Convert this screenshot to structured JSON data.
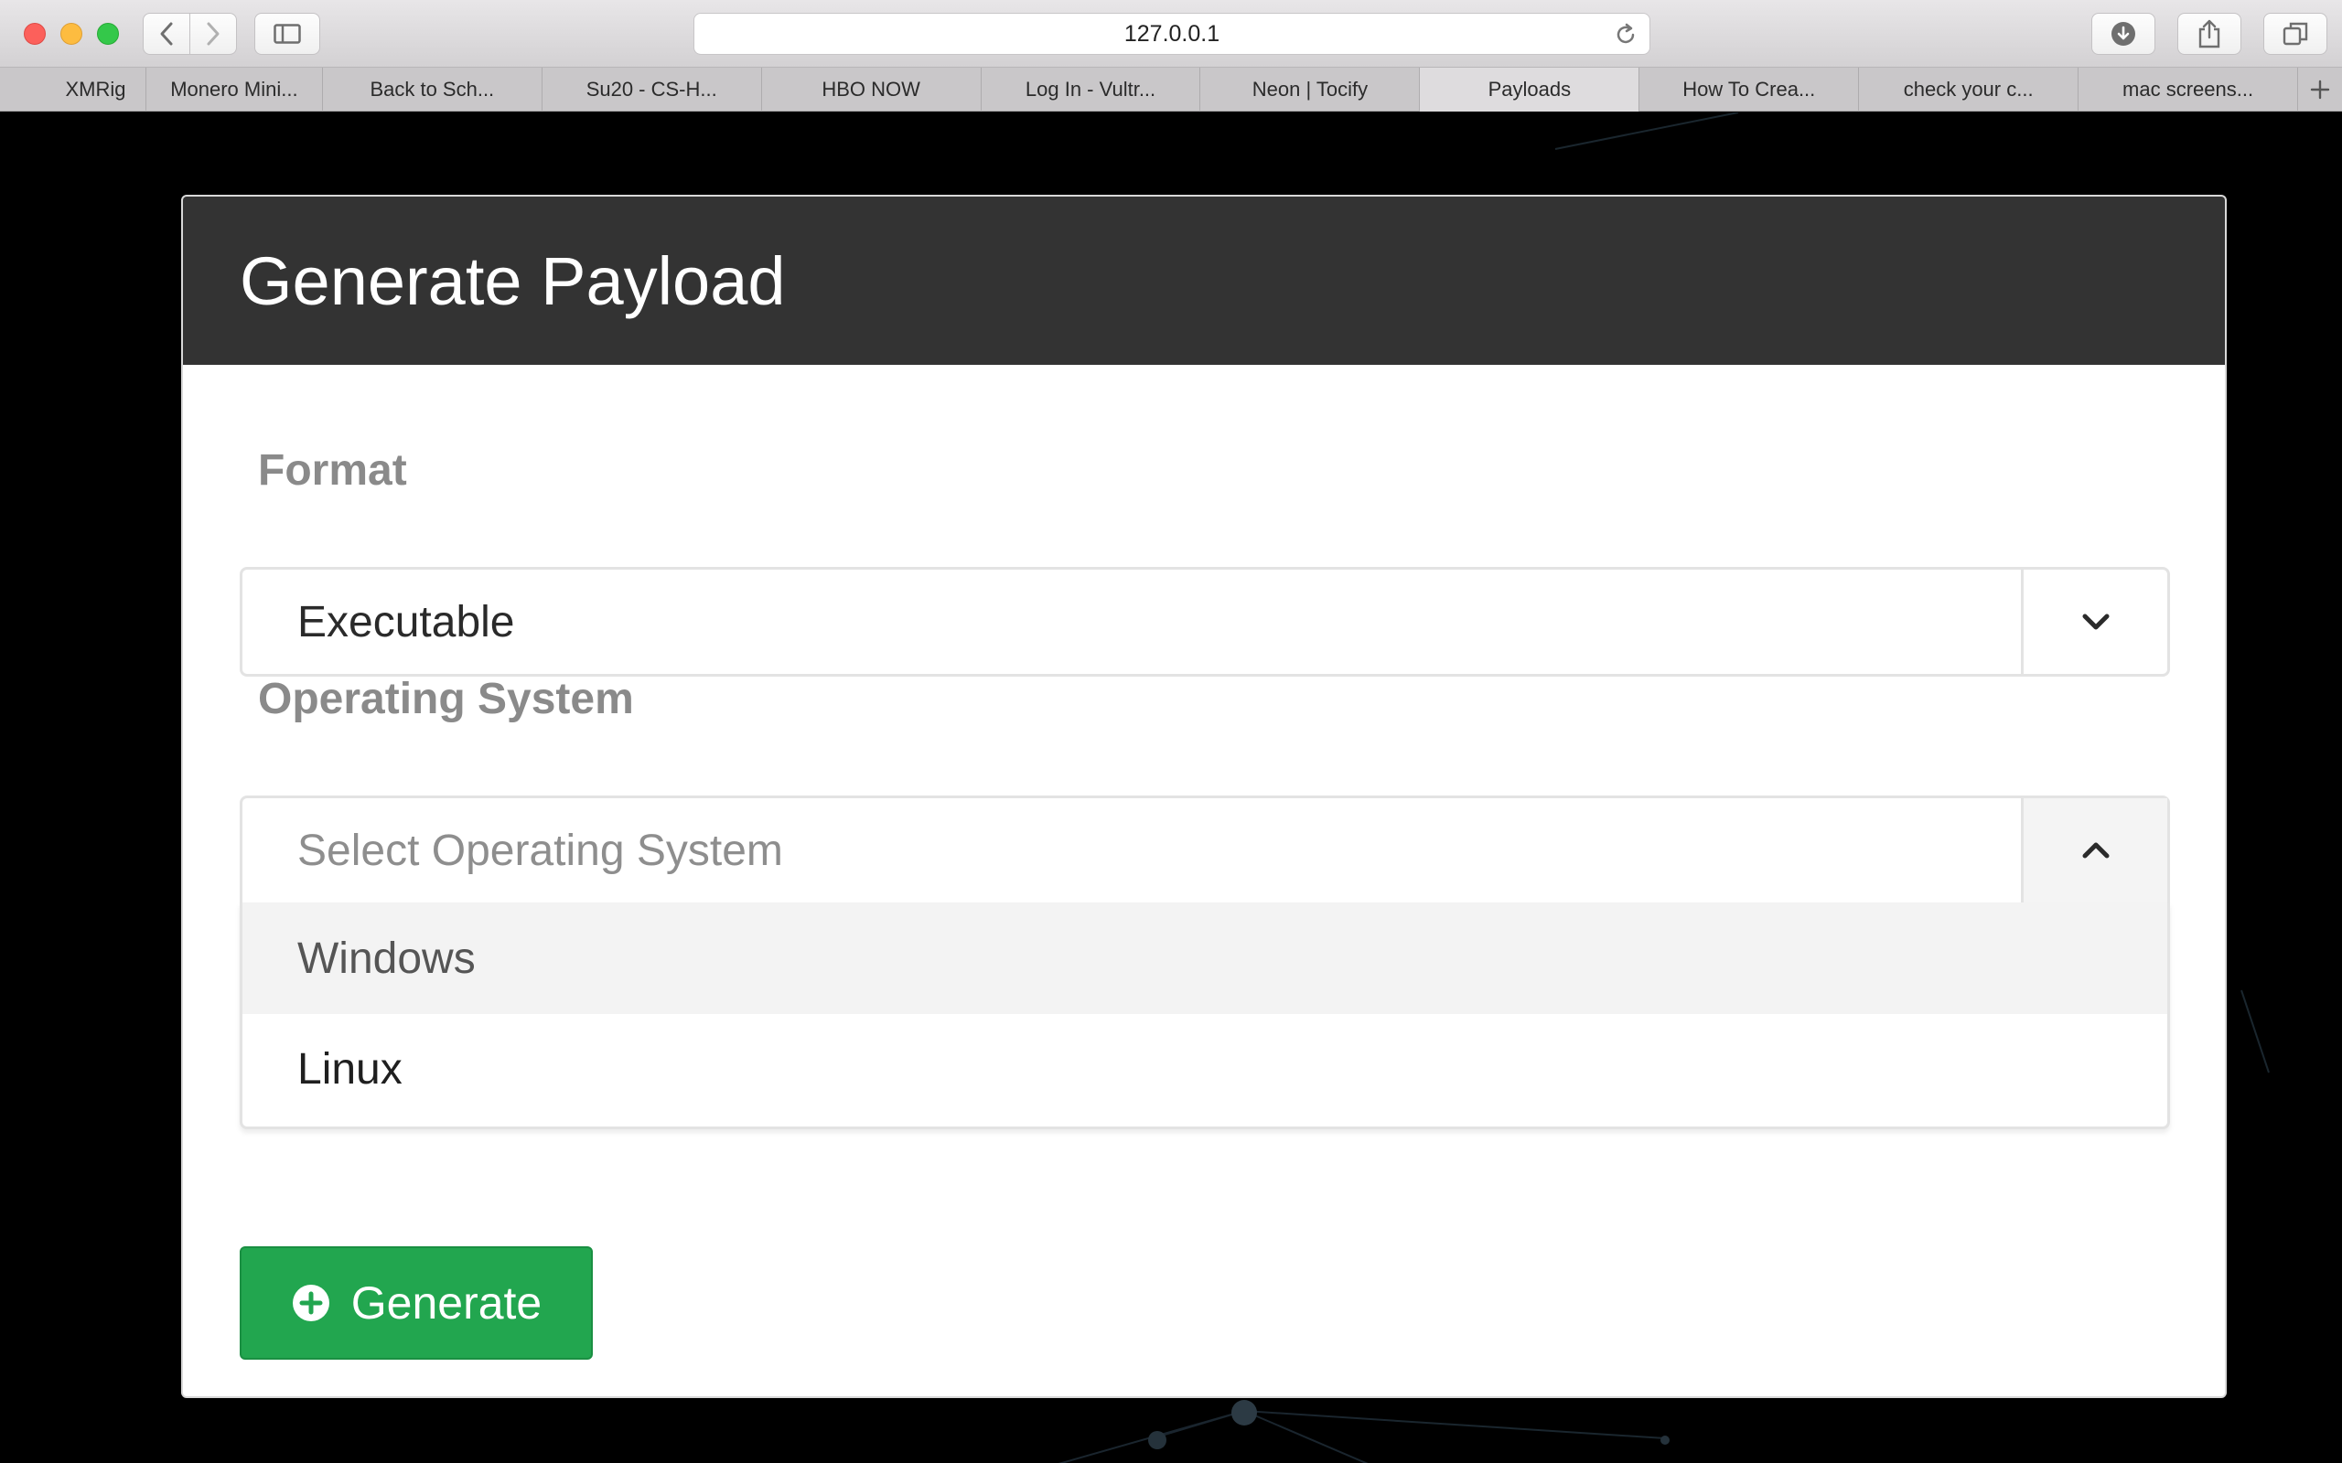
{
  "browser": {
    "url": "127.0.0.1",
    "tabs": [
      {
        "label": "XMRig",
        "active": false
      },
      {
        "label": "Monero Mini...",
        "active": false
      },
      {
        "label": "Back to Sch...",
        "active": false
      },
      {
        "label": "Su20 - CS-H...",
        "active": false
      },
      {
        "label": "HBO NOW",
        "active": false
      },
      {
        "label": "Log In - Vultr...",
        "active": false
      },
      {
        "label": "Neon | Tocify",
        "active": false
      },
      {
        "label": "Payloads",
        "active": true
      },
      {
        "label": "How To Crea...",
        "active": false
      },
      {
        "label": "check your c...",
        "active": false
      },
      {
        "label": "mac screens...",
        "active": false
      }
    ],
    "icons": {
      "back": "chevron-left-icon",
      "forward": "chevron-right-icon",
      "sidebar": "sidebar-icon",
      "reload": "reload-icon",
      "downloads": "download-icon",
      "share": "share-icon",
      "tabs_overview": "tabs-icon",
      "new_tab": "plus-icon"
    }
  },
  "card": {
    "title": "Generate Payload"
  },
  "form": {
    "format_label": "Format",
    "format_value": "Executable",
    "os_label": "Operating System",
    "os_placeholder": "Select Operating System",
    "os_options": [
      "Windows",
      "Linux"
    ],
    "generate_label": "Generate"
  },
  "colors": {
    "header_bg": "#333333",
    "button_green": "#22a64f",
    "page_bg": "#000000"
  }
}
